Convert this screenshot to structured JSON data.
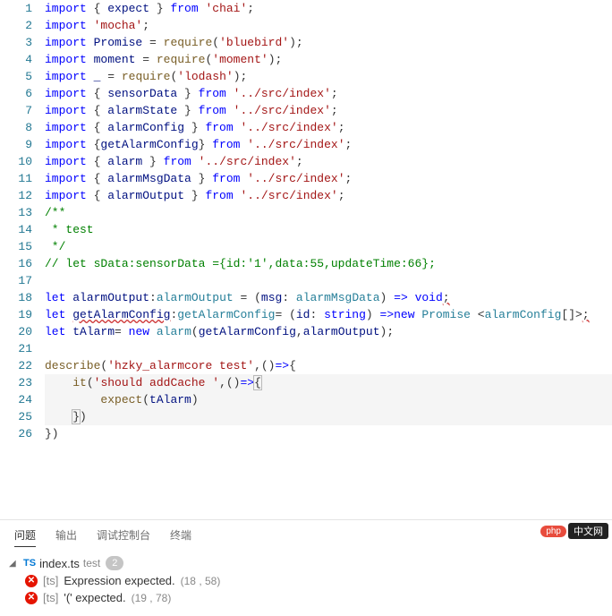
{
  "lines": {
    "1": [
      {
        "t": "import",
        "c": "kw"
      },
      {
        "t": " { "
      },
      {
        "t": "expect",
        "c": "ident"
      },
      {
        "t": " } "
      },
      {
        "t": "from",
        "c": "kw"
      },
      {
        "t": " "
      },
      {
        "t": "'chai'",
        "c": "str"
      },
      {
        "t": ";"
      }
    ],
    "2": [
      {
        "t": "import",
        "c": "kw"
      },
      {
        "t": " "
      },
      {
        "t": "'mocha'",
        "c": "str"
      },
      {
        "t": ";"
      }
    ],
    "3": [
      {
        "t": "import",
        "c": "kw"
      },
      {
        "t": " "
      },
      {
        "t": "Promise",
        "c": "ident"
      },
      {
        "t": " = "
      },
      {
        "t": "require",
        "c": "fn"
      },
      {
        "t": "("
      },
      {
        "t": "'bluebird'",
        "c": "str"
      },
      {
        "t": ");"
      }
    ],
    "4": [
      {
        "t": "import",
        "c": "kw"
      },
      {
        "t": " "
      },
      {
        "t": "moment",
        "c": "ident"
      },
      {
        "t": " = "
      },
      {
        "t": "require",
        "c": "fn"
      },
      {
        "t": "("
      },
      {
        "t": "'moment'",
        "c": "str"
      },
      {
        "t": ");"
      }
    ],
    "5": [
      {
        "t": "import",
        "c": "kw"
      },
      {
        "t": " "
      },
      {
        "t": "_",
        "c": "ident"
      },
      {
        "t": " = "
      },
      {
        "t": "require",
        "c": "fn"
      },
      {
        "t": "("
      },
      {
        "t": "'lodash'",
        "c": "str"
      },
      {
        "t": ");"
      }
    ],
    "6": [
      {
        "t": "import",
        "c": "kw"
      },
      {
        "t": " { "
      },
      {
        "t": "sensorData",
        "c": "ident"
      },
      {
        "t": " } "
      },
      {
        "t": "from",
        "c": "kw"
      },
      {
        "t": " "
      },
      {
        "t": "'../src/index'",
        "c": "str"
      },
      {
        "t": ";"
      }
    ],
    "7": [
      {
        "t": "import",
        "c": "kw"
      },
      {
        "t": " { "
      },
      {
        "t": "alarmState",
        "c": "ident"
      },
      {
        "t": " } "
      },
      {
        "t": "from",
        "c": "kw"
      },
      {
        "t": " "
      },
      {
        "t": "'../src/index'",
        "c": "str"
      },
      {
        "t": ";"
      }
    ],
    "8": [
      {
        "t": "import",
        "c": "kw"
      },
      {
        "t": " { "
      },
      {
        "t": "alarmConfig",
        "c": "ident"
      },
      {
        "t": " } "
      },
      {
        "t": "from",
        "c": "kw"
      },
      {
        "t": " "
      },
      {
        "t": "'../src/index'",
        "c": "str"
      },
      {
        "t": ";"
      }
    ],
    "9": [
      {
        "t": "import",
        "c": "kw"
      },
      {
        "t": " {"
      },
      {
        "t": "getAlarmConfig",
        "c": "ident"
      },
      {
        "t": "} "
      },
      {
        "t": "from",
        "c": "kw"
      },
      {
        "t": " "
      },
      {
        "t": "'../src/index'",
        "c": "str"
      },
      {
        "t": ";"
      }
    ],
    "10": [
      {
        "t": "import",
        "c": "kw"
      },
      {
        "t": " { "
      },
      {
        "t": "alarm",
        "c": "ident"
      },
      {
        "t": " } "
      },
      {
        "t": "from",
        "c": "kw"
      },
      {
        "t": " "
      },
      {
        "t": "'../src/index'",
        "c": "str"
      },
      {
        "t": ";"
      }
    ],
    "11": [
      {
        "t": "import",
        "c": "kw"
      },
      {
        "t": " { "
      },
      {
        "t": "alarmMsgData",
        "c": "ident"
      },
      {
        "t": " } "
      },
      {
        "t": "from",
        "c": "kw"
      },
      {
        "t": " "
      },
      {
        "t": "'../src/index'",
        "c": "str"
      },
      {
        "t": ";"
      }
    ],
    "12": [
      {
        "t": "import",
        "c": "kw"
      },
      {
        "t": " { "
      },
      {
        "t": "alarmOutput",
        "c": "ident"
      },
      {
        "t": " } "
      },
      {
        "t": "from",
        "c": "kw"
      },
      {
        "t": " "
      },
      {
        "t": "'../src/index'",
        "c": "str"
      },
      {
        "t": ";"
      }
    ],
    "13": [
      {
        "t": "/**",
        "c": "comment"
      }
    ],
    "14": [
      {
        "t": " * test",
        "c": "comment"
      }
    ],
    "15": [
      {
        "t": " */",
        "c": "comment"
      }
    ],
    "16": [
      {
        "t": "// let sData:sensorData ={id:'1',data:55,updateTime:66};",
        "c": "comment"
      }
    ],
    "17": [
      {
        "t": ""
      }
    ],
    "18": [
      {
        "t": "let",
        "c": "kw"
      },
      {
        "t": " "
      },
      {
        "t": "alarmOutput",
        "c": "ident"
      },
      {
        "t": ":"
      },
      {
        "t": "alarmOutput",
        "c": "type"
      },
      {
        "t": " = ("
      },
      {
        "t": "msg",
        "c": "param"
      },
      {
        "t": ": "
      },
      {
        "t": "alarmMsgData",
        "c": "type"
      },
      {
        "t": ") "
      },
      {
        "t": "=>",
        "c": "kw"
      },
      {
        "t": " "
      },
      {
        "t": "void",
        "c": "kw"
      },
      {
        "t": ";",
        "c": "underline-err"
      }
    ],
    "19": [
      {
        "t": "let",
        "c": "kw"
      },
      {
        "t": " "
      },
      {
        "t": "getAlarmConfig",
        "c": "ident underline-err"
      },
      {
        "t": ":"
      },
      {
        "t": "getAlarmConfig",
        "c": "type"
      },
      {
        "t": "= ("
      },
      {
        "t": "id",
        "c": "param"
      },
      {
        "t": ": "
      },
      {
        "t": "string",
        "c": "kw"
      },
      {
        "t": ") "
      },
      {
        "t": "=>",
        "c": "kw"
      },
      {
        "t": "new",
        "c": "kw"
      },
      {
        "t": " "
      },
      {
        "t": "Promise",
        "c": "type"
      },
      {
        "t": " <"
      },
      {
        "t": "alarmConfig",
        "c": "type"
      },
      {
        "t": "[]>"
      },
      {
        "t": ";",
        "c": "underline-err"
      }
    ],
    "20": [
      {
        "t": "let",
        "c": "kw"
      },
      {
        "t": " "
      },
      {
        "t": "tAlarm",
        "c": "ident"
      },
      {
        "t": "= "
      },
      {
        "t": "new",
        "c": "kw"
      },
      {
        "t": " "
      },
      {
        "t": "alarm",
        "c": "type"
      },
      {
        "t": "("
      },
      {
        "t": "getAlarmConfig",
        "c": "ident"
      },
      {
        "t": ","
      },
      {
        "t": "alarmOutput",
        "c": "ident"
      },
      {
        "t": ");"
      }
    ],
    "21": [
      {
        "t": ""
      }
    ],
    "22": [
      {
        "t": "describe",
        "c": "fn"
      },
      {
        "t": "("
      },
      {
        "t": "'hzky_alarmcore test'",
        "c": "str"
      },
      {
        "t": ",()"
      },
      {
        "t": "=>",
        "c": "kw"
      },
      {
        "t": "{"
      }
    ],
    "23": [
      {
        "t": "    "
      },
      {
        "t": "it",
        "c": "fn"
      },
      {
        "t": "("
      },
      {
        "t": "'should addCache '",
        "c": "str"
      },
      {
        "t": ",()"
      },
      {
        "t": "=>",
        "c": "kw"
      },
      {
        "t": "{",
        "c": "bracket-match"
      }
    ],
    "24": [
      {
        "t": "        "
      },
      {
        "t": "expect",
        "c": "fn"
      },
      {
        "t": "("
      },
      {
        "t": "tAlarm",
        "c": "ident"
      },
      {
        "t": ")"
      }
    ],
    "25": [
      {
        "t": "    "
      },
      {
        "t": "}",
        "c": "bracket-match"
      },
      {
        "t": ")"
      }
    ],
    "26": [
      {
        "t": "})"
      }
    ]
  },
  "lineCount": 26,
  "highlightedLines": [
    23,
    24,
    25
  ],
  "panel": {
    "tabs": [
      "问题",
      "输出",
      "调试控制台",
      "终端"
    ],
    "activeTab": 0,
    "file": {
      "icon": "TS",
      "name": "index.ts",
      "dir": "test",
      "count": "2"
    },
    "problems": [
      {
        "source": "[ts]",
        "msg": "Expression expected.",
        "loc": "(18 , 58)"
      },
      {
        "source": "[ts]",
        "msg": "'(' expected.",
        "loc": "(19 , 78)"
      }
    ]
  },
  "watermark": {
    "badge": "php",
    "text": "中文网"
  }
}
